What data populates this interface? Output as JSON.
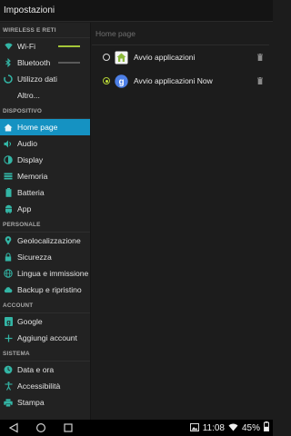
{
  "window": {
    "title": "Impostazioni"
  },
  "sidebar": {
    "sections": [
      {
        "header": "WIRELESS E RETI",
        "items": [
          {
            "label": "Wi-Fi",
            "icon": "wifi-icon",
            "toggle": "on"
          },
          {
            "label": "Bluetooth",
            "icon": "bluetooth-icon",
            "toggle": "off"
          },
          {
            "label": "Utilizzo dati",
            "icon": "data-usage-icon"
          },
          {
            "label": "Altro...",
            "icon": ""
          }
        ]
      },
      {
        "header": "DISPOSITIVO",
        "items": [
          {
            "label": "Home page",
            "icon": "home-icon",
            "selected": true
          },
          {
            "label": "Audio",
            "icon": "volume-icon"
          },
          {
            "label": "Display",
            "icon": "brightness-icon"
          },
          {
            "label": "Memoria",
            "icon": "storage-icon"
          },
          {
            "label": "Batteria",
            "icon": "battery-icon"
          },
          {
            "label": "App",
            "icon": "android-icon"
          }
        ]
      },
      {
        "header": "PERSONALE",
        "items": [
          {
            "label": "Geolocalizzazione",
            "icon": "location-icon"
          },
          {
            "label": "Sicurezza",
            "icon": "lock-icon"
          },
          {
            "label": "Lingua e immissione",
            "icon": "globe-icon"
          },
          {
            "label": "Backup e ripristino",
            "icon": "cloud-upload-icon"
          }
        ]
      },
      {
        "header": "ACCOUNT",
        "items": [
          {
            "label": "Google",
            "icon": "google-icon"
          },
          {
            "label": "Aggiungi account",
            "icon": "plus-icon"
          }
        ]
      },
      {
        "header": "SISTEMA",
        "items": [
          {
            "label": "Data e ora",
            "icon": "clock-icon"
          },
          {
            "label": "Accessibilità",
            "icon": "accessibility-icon"
          },
          {
            "label": "Stampa",
            "icon": "printer-icon"
          }
        ]
      }
    ]
  },
  "content": {
    "header": "Home page",
    "options": [
      {
        "label": "Avvio applicazioni",
        "selected": false,
        "icon": "launcher-house-icon"
      },
      {
        "label": "Avvio applicazioni Now",
        "selected": true,
        "icon": "google-g-icon"
      }
    ]
  },
  "statusbar": {
    "time": "11:08",
    "battery": "45%"
  },
  "colors": {
    "accent": "#1592c2",
    "selected_radio": "#c4e23c",
    "icon_teal": "#33b5a5",
    "toggle_on": "#a4c639"
  }
}
